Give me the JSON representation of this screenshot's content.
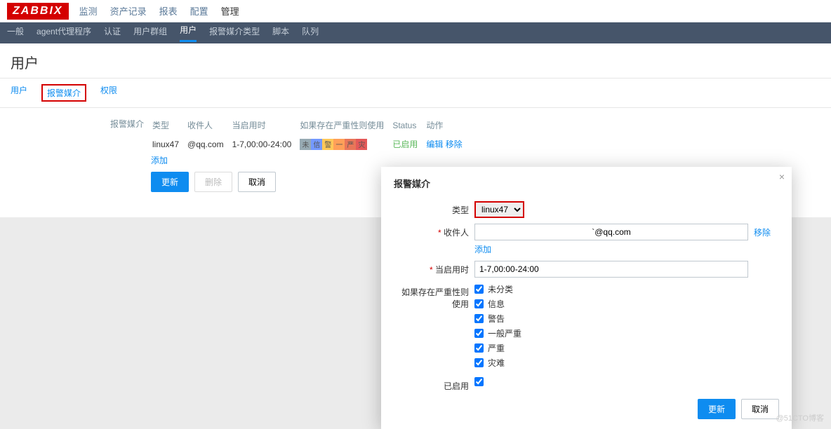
{
  "logo": "ZABBIX",
  "topmenu": [
    {
      "label": "监测",
      "active": false
    },
    {
      "label": "资产记录",
      "active": false
    },
    {
      "label": "报表",
      "active": false
    },
    {
      "label": "配置",
      "active": false
    },
    {
      "label": "管理",
      "active": true
    }
  ],
  "submenu": [
    {
      "label": "一般",
      "active": false
    },
    {
      "label": "agent代理程序",
      "active": false
    },
    {
      "label": "认证",
      "active": false
    },
    {
      "label": "用户群组",
      "active": false
    },
    {
      "label": "用户",
      "active": true
    },
    {
      "label": "报警媒介类型",
      "active": false
    },
    {
      "label": "脚本",
      "active": false
    },
    {
      "label": "队列",
      "active": false
    }
  ],
  "page_title": "用户",
  "tabs": [
    {
      "label": "用户",
      "sel": false
    },
    {
      "label": "报警媒介",
      "sel": true
    },
    {
      "label": "权限",
      "sel": false
    }
  ],
  "section_label": "报警媒介",
  "table": {
    "headers": [
      "类型",
      "收件人",
      "当启用时",
      "如果存在严重性则使用",
      "Status",
      "动作"
    ],
    "row": {
      "type": "linux47",
      "recipient": "@qq.com",
      "when": "1-7,00:00-24:00",
      "severities": [
        {
          "txt": "未",
          "bg": "#97AAB3"
        },
        {
          "txt": "信",
          "bg": "#7499FF"
        },
        {
          "txt": "警",
          "bg": "#FFC859"
        },
        {
          "txt": "一",
          "bg": "#FFA059"
        },
        {
          "txt": "严",
          "bg": "#E97659"
        },
        {
          "txt": "灾",
          "bg": "#E45959"
        }
      ],
      "status": "已启用",
      "edit": "编辑",
      "remove": "移除"
    },
    "add": "添加"
  },
  "buttons": {
    "update": "更新",
    "delete": "删除",
    "cancel": "取消"
  },
  "modal": {
    "title": "报警媒介",
    "type_label": "类型",
    "type_value": "linux47",
    "recipient_label": "收件人",
    "recipient_value": "`@qq.com",
    "remove": "移除",
    "add": "添加",
    "when_label": "当启用时",
    "when_value": "1-7,00:00-24:00",
    "severity_label": "如果存在严重性则使用",
    "severities": [
      "未分类",
      "信息",
      "警告",
      "一般严重",
      "严重",
      "灾难"
    ],
    "enabled_label": "已启用",
    "update": "更新",
    "cancel": "取消"
  },
  "watermark": "@51CTO博客"
}
